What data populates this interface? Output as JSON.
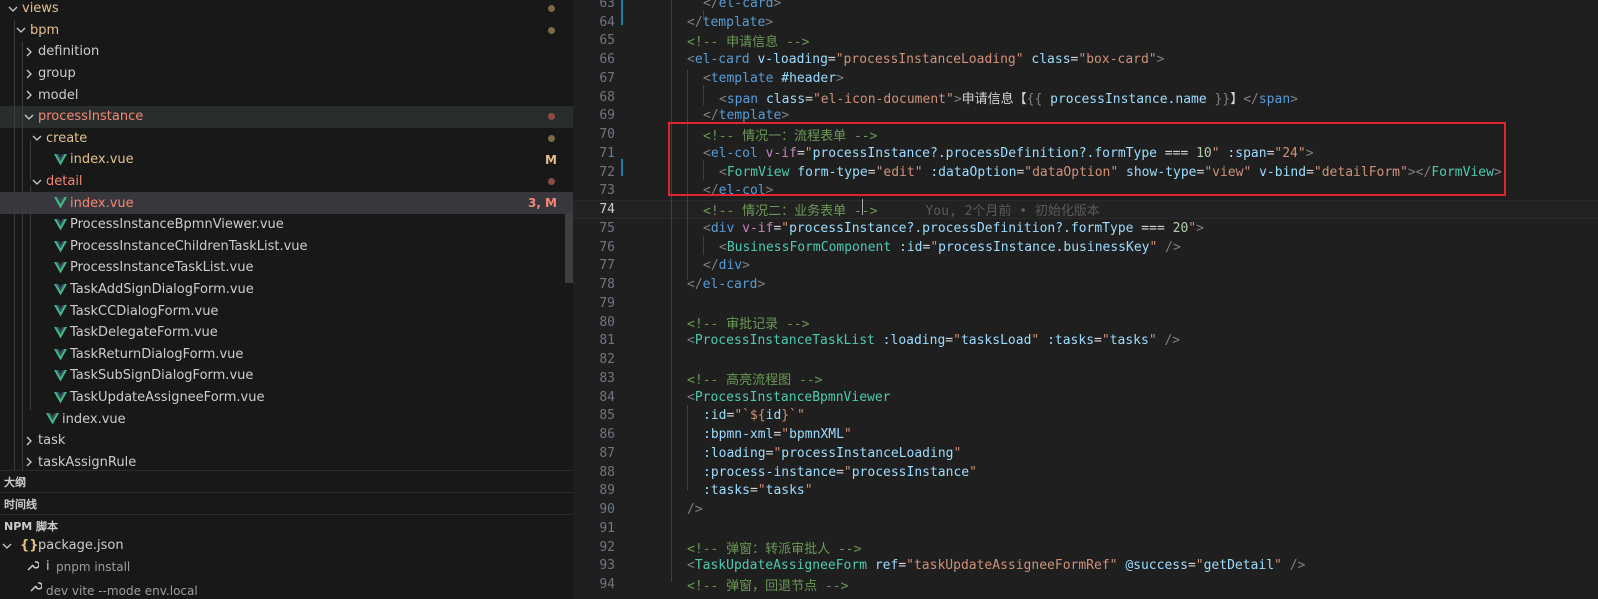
{
  "explorer": {
    "rows": [
      {
        "label": "views",
        "kind": "folder",
        "open": true,
        "depth": 0,
        "status": "git",
        "dot": true
      },
      {
        "label": "bpm",
        "kind": "folder",
        "open": true,
        "depth": 1,
        "status": "git",
        "dot": true
      },
      {
        "label": "definition",
        "kind": "folder",
        "open": false,
        "depth": 2,
        "status": "",
        "dot": false
      },
      {
        "label": "group",
        "kind": "folder",
        "open": false,
        "depth": 2,
        "status": "",
        "dot": false
      },
      {
        "label": "model",
        "kind": "folder",
        "open": false,
        "depth": 2,
        "status": "",
        "dot": false
      },
      {
        "label": "processInstance",
        "kind": "folder",
        "open": true,
        "depth": 2,
        "status": "err",
        "dot": true,
        "hover": true
      },
      {
        "label": "create",
        "kind": "folder",
        "open": true,
        "depth": 3,
        "status": "git",
        "dot": true
      },
      {
        "label": "index.vue",
        "kind": "vue",
        "depth": 4,
        "status": "git",
        "badge": "M"
      },
      {
        "label": "detail",
        "kind": "folder",
        "open": true,
        "depth": 3,
        "status": "err",
        "dot": true
      },
      {
        "label": "index.vue",
        "kind": "vue",
        "depth": 4,
        "status": "err",
        "badge": "3, M",
        "active": true
      },
      {
        "label": "ProcessInstanceBpmnViewer.vue",
        "kind": "vue",
        "depth": 4,
        "status": ""
      },
      {
        "label": "ProcessInstanceChildrenTaskList.vue",
        "kind": "vue",
        "depth": 4,
        "status": ""
      },
      {
        "label": "ProcessInstanceTaskList.vue",
        "kind": "vue",
        "depth": 4,
        "status": ""
      },
      {
        "label": "TaskAddSignDialogForm.vue",
        "kind": "vue",
        "depth": 4,
        "status": ""
      },
      {
        "label": "TaskCCDialogForm.vue",
        "kind": "vue",
        "depth": 4,
        "status": ""
      },
      {
        "label": "TaskDelegateForm.vue",
        "kind": "vue",
        "depth": 4,
        "status": ""
      },
      {
        "label": "TaskReturnDialogForm.vue",
        "kind": "vue",
        "depth": 4,
        "status": ""
      },
      {
        "label": "TaskSubSignDialogForm.vue",
        "kind": "vue",
        "depth": 4,
        "status": ""
      },
      {
        "label": "TaskUpdateAssigneeForm.vue",
        "kind": "vue",
        "depth": 4,
        "status": ""
      },
      {
        "label": "index.vue",
        "kind": "vue",
        "depth": 3,
        "status": ""
      },
      {
        "label": "task",
        "kind": "folder",
        "open": false,
        "depth": 2,
        "status": "",
        "dot": false
      },
      {
        "label": "taskAssignRule",
        "kind": "folder",
        "open": false,
        "depth": 2,
        "status": "",
        "dot": false
      }
    ]
  },
  "sections": {
    "outline": "大纲",
    "timeline": "时间线",
    "npm": "NPM 脚本"
  },
  "npm": {
    "package": "package.json",
    "script_name": "i",
    "script_cmd": "pnpm install",
    "partial_row": "dev  vite --mode env.local"
  },
  "editor": {
    "current_line": 74,
    "blame": "You, 2个月前 • 初始化版本",
    "lines": [
      {
        "n": 63,
        "indent": 2,
        "tokens": [
          [
            "punct",
            "</"
          ],
          [
            "tag",
            "el-card"
          ],
          [
            "punct",
            ">"
          ]
        ]
      },
      {
        "n": 64,
        "indent": 1,
        "tokens": [
          [
            "punct",
            "</"
          ],
          [
            "tag",
            "template"
          ],
          [
            "punct",
            ">"
          ]
        ]
      },
      {
        "n": 65,
        "indent": 1,
        "tokens": [
          [
            "cmt",
            "<!-- 申请信息 -->"
          ]
        ]
      },
      {
        "n": 66,
        "indent": 1,
        "tokens": [
          [
            "punct",
            "<"
          ],
          [
            "tag",
            "el-card"
          ],
          [
            "text",
            " "
          ],
          [
            "attr",
            "v-loading"
          ],
          [
            "text",
            "="
          ],
          [
            "str",
            "\"processInstanceLoading\""
          ],
          [
            "text",
            " "
          ],
          [
            "attr",
            "class"
          ],
          [
            "text",
            "="
          ],
          [
            "str",
            "\"box-card\""
          ],
          [
            "punct",
            ">"
          ]
        ]
      },
      {
        "n": 67,
        "indent": 2,
        "tokens": [
          [
            "punct",
            "<"
          ],
          [
            "tag",
            "template"
          ],
          [
            "text",
            " "
          ],
          [
            "attr",
            "#header"
          ],
          [
            "punct",
            ">"
          ]
        ]
      },
      {
        "n": 68,
        "indent": 3,
        "tokens": [
          [
            "punct",
            "<"
          ],
          [
            "tag",
            "span"
          ],
          [
            "text",
            " "
          ],
          [
            "attr",
            "class"
          ],
          [
            "text",
            "="
          ],
          [
            "str",
            "\"el-icon-document\""
          ],
          [
            "punct",
            ">"
          ],
          [
            "text",
            "申请信息【"
          ],
          [
            "punct",
            "{{ "
          ],
          [
            "var",
            "processInstance.name"
          ],
          [
            "punct",
            " }}"
          ],
          [
            "text",
            "】"
          ],
          [
            "punct",
            "</"
          ],
          [
            "tag",
            "span"
          ],
          [
            "punct",
            ">"
          ]
        ]
      },
      {
        "n": 69,
        "indent": 2,
        "tokens": [
          [
            "punct",
            "</"
          ],
          [
            "tag",
            "template"
          ],
          [
            "punct",
            ">"
          ]
        ]
      },
      {
        "n": 70,
        "indent": 2,
        "tokens": [
          [
            "cmt",
            "<!-- 情况一：流程表单 -->"
          ]
        ]
      },
      {
        "n": 71,
        "indent": 2,
        "tokens": [
          [
            "punct",
            "<"
          ],
          [
            "tag",
            "el-col"
          ],
          [
            "text",
            " "
          ],
          [
            "ctrl",
            "v-if"
          ],
          [
            "text",
            "="
          ],
          [
            "str",
            "\""
          ],
          [
            "var",
            "processInstance?.processDefinition?.formType"
          ],
          [
            "text",
            " === "
          ],
          [
            "num",
            "10"
          ],
          [
            "str",
            "\""
          ],
          [
            "text",
            " "
          ],
          [
            "attr",
            ":span"
          ],
          [
            "text",
            "="
          ],
          [
            "str",
            "\"24\""
          ],
          [
            "punct",
            ">"
          ]
        ]
      },
      {
        "n": 72,
        "indent": 3,
        "tokens": [
          [
            "punct",
            "<"
          ],
          [
            "comp",
            "FormView"
          ],
          [
            "text",
            " "
          ],
          [
            "attr",
            "form-type"
          ],
          [
            "text",
            "="
          ],
          [
            "str",
            "\"edit\""
          ],
          [
            "text",
            " "
          ],
          [
            "attr",
            ":dataOption"
          ],
          [
            "text",
            "="
          ],
          [
            "str",
            "\"dataOption\""
          ],
          [
            "text",
            " "
          ],
          [
            "attr",
            "show-type"
          ],
          [
            "text",
            "="
          ],
          [
            "str",
            "\"view\""
          ],
          [
            "text",
            " "
          ],
          [
            "attr",
            "v-bind"
          ],
          [
            "text",
            "="
          ],
          [
            "str",
            "\"detailForm\""
          ],
          [
            "punct",
            "></"
          ],
          [
            "comp",
            "FormView"
          ],
          [
            "punct",
            ">"
          ]
        ]
      },
      {
        "n": 73,
        "indent": 2,
        "tokens": [
          [
            "punct",
            "</"
          ],
          [
            "tag",
            "el-col"
          ],
          [
            "punct",
            ">"
          ]
        ]
      },
      {
        "n": 74,
        "indent": 2,
        "tokens": [
          [
            "cmt",
            "<!-- 情况二：业务表单 -->"
          ]
        ]
      },
      {
        "n": 75,
        "indent": 2,
        "tokens": [
          [
            "punct",
            "<"
          ],
          [
            "tag",
            "div"
          ],
          [
            "text",
            " "
          ],
          [
            "ctrl",
            "v-if"
          ],
          [
            "text",
            "="
          ],
          [
            "str",
            "\""
          ],
          [
            "var",
            "processInstance?.processDefinition?.formType"
          ],
          [
            "text",
            " === "
          ],
          [
            "num",
            "20"
          ],
          [
            "str",
            "\""
          ],
          [
            "punct",
            ">"
          ]
        ]
      },
      {
        "n": 76,
        "indent": 3,
        "tokens": [
          [
            "punct",
            "<"
          ],
          [
            "comp",
            "BusinessFormComponent"
          ],
          [
            "text",
            " "
          ],
          [
            "attr",
            ":id"
          ],
          [
            "text",
            "="
          ],
          [
            "str",
            "\""
          ],
          [
            "var",
            "processInstance.businessKey"
          ],
          [
            "str",
            "\""
          ],
          [
            "text",
            " "
          ],
          [
            "punct",
            "/>"
          ]
        ]
      },
      {
        "n": 77,
        "indent": 2,
        "tokens": [
          [
            "punct",
            "</"
          ],
          [
            "tag",
            "div"
          ],
          [
            "punct",
            ">"
          ]
        ]
      },
      {
        "n": 78,
        "indent": 1,
        "tokens": [
          [
            "punct",
            "</"
          ],
          [
            "tag",
            "el-card"
          ],
          [
            "punct",
            ">"
          ]
        ]
      },
      {
        "n": 79,
        "indent": 0,
        "tokens": []
      },
      {
        "n": 80,
        "indent": 1,
        "tokens": [
          [
            "cmt",
            "<!-- 审批记录 -->"
          ]
        ]
      },
      {
        "n": 81,
        "indent": 1,
        "tokens": [
          [
            "punct",
            "<"
          ],
          [
            "comp",
            "ProcessInstanceTaskList"
          ],
          [
            "text",
            " "
          ],
          [
            "attr",
            ":loading"
          ],
          [
            "text",
            "="
          ],
          [
            "str",
            "\""
          ],
          [
            "var",
            "tasksLoad"
          ],
          [
            "str",
            "\""
          ],
          [
            "text",
            " "
          ],
          [
            "attr",
            ":tasks"
          ],
          [
            "text",
            "="
          ],
          [
            "str",
            "\""
          ],
          [
            "var",
            "tasks"
          ],
          [
            "str",
            "\""
          ],
          [
            "text",
            " "
          ],
          [
            "punct",
            "/>"
          ]
        ]
      },
      {
        "n": 82,
        "indent": 0,
        "tokens": []
      },
      {
        "n": 83,
        "indent": 1,
        "tokens": [
          [
            "cmt",
            "<!-- 高亮流程图 -->"
          ]
        ]
      },
      {
        "n": 84,
        "indent": 1,
        "tokens": [
          [
            "punct",
            "<"
          ],
          [
            "comp",
            "ProcessInstanceBpmnViewer"
          ]
        ]
      },
      {
        "n": 85,
        "indent": 2,
        "tokens": [
          [
            "attr",
            ":id"
          ],
          [
            "text",
            "="
          ],
          [
            "str",
            "\""
          ],
          [
            "tmpl",
            "`${"
          ],
          [
            "var",
            "id"
          ],
          [
            "tmpl",
            "}`"
          ],
          [
            "str",
            "\""
          ]
        ]
      },
      {
        "n": 86,
        "indent": 2,
        "tokens": [
          [
            "attr",
            ":bpmn-xml"
          ],
          [
            "text",
            "="
          ],
          [
            "str",
            "\""
          ],
          [
            "var",
            "bpmnXML"
          ],
          [
            "str",
            "\""
          ]
        ]
      },
      {
        "n": 87,
        "indent": 2,
        "tokens": [
          [
            "attr",
            ":loading"
          ],
          [
            "text",
            "="
          ],
          [
            "str",
            "\""
          ],
          [
            "var",
            "processInstanceLoading"
          ],
          [
            "str",
            "\""
          ]
        ]
      },
      {
        "n": 88,
        "indent": 2,
        "tokens": [
          [
            "attr",
            ":process-instance"
          ],
          [
            "text",
            "="
          ],
          [
            "str",
            "\""
          ],
          [
            "var",
            "processInstance"
          ],
          [
            "str",
            "\""
          ]
        ]
      },
      {
        "n": 89,
        "indent": 2,
        "tokens": [
          [
            "attr",
            ":tasks"
          ],
          [
            "text",
            "="
          ],
          [
            "str",
            "\""
          ],
          [
            "var",
            "tasks"
          ],
          [
            "str",
            "\""
          ]
        ]
      },
      {
        "n": 90,
        "indent": 1,
        "tokens": [
          [
            "punct",
            "/>"
          ]
        ]
      },
      {
        "n": 91,
        "indent": 0,
        "tokens": []
      },
      {
        "n": 92,
        "indent": 1,
        "tokens": [
          [
            "cmt",
            "<!-- 弹窗：转派审批人 -->"
          ]
        ]
      },
      {
        "n": 93,
        "indent": 1,
        "tokens": [
          [
            "punct",
            "<"
          ],
          [
            "comp",
            "TaskUpdateAssigneeForm"
          ],
          [
            "text",
            " "
          ],
          [
            "attr",
            "ref"
          ],
          [
            "text",
            "="
          ],
          [
            "str",
            "\"taskUpdateAssigneeFormRef\""
          ],
          [
            "text",
            " "
          ],
          [
            "attr",
            "@success"
          ],
          [
            "text",
            "="
          ],
          [
            "str",
            "\""
          ],
          [
            "var",
            "getDetail"
          ],
          [
            "str",
            "\""
          ],
          [
            "text",
            " "
          ],
          [
            "punct",
            "/>"
          ]
        ]
      },
      {
        "n": 94,
        "indent": 1,
        "tokens": [
          [
            "cmt",
            "<!-- 弹窗，回退节点 -->"
          ]
        ]
      }
    ]
  },
  "colors": {
    "git_modified": "#e2c08d",
    "error": "#f48771",
    "vue_green": "#41b883",
    "highlight_box": "#e0252f"
  }
}
